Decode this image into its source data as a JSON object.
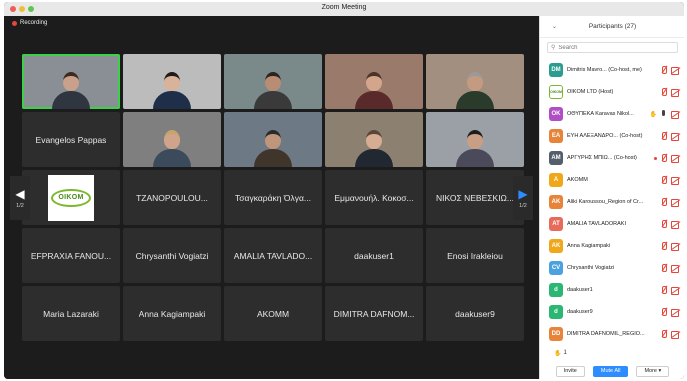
{
  "window": {
    "title": "Zoom Meeting"
  },
  "meeting": {
    "recording_label": "Recording",
    "page_left": "1/2",
    "page_right": "1/2",
    "logo_text": "OIKOM",
    "tiles": [
      {
        "kind": "video"
      },
      {
        "kind": "video"
      },
      {
        "kind": "video"
      },
      {
        "kind": "video"
      },
      {
        "kind": "video"
      },
      {
        "kind": "name",
        "name": "Evangelos Pappas"
      },
      {
        "kind": "video"
      },
      {
        "kind": "video"
      },
      {
        "kind": "video"
      },
      {
        "kind": "video"
      },
      {
        "kind": "logo"
      },
      {
        "kind": "name",
        "name": "TZANOPOULOU..."
      },
      {
        "kind": "name",
        "name": "Τσαγκαράκη Όλγα..."
      },
      {
        "kind": "name",
        "name": "Εμμανουήλ. Κοκοσ..."
      },
      {
        "kind": "name",
        "name": "ΝΙΚΟΣ ΝΕΒΕΣΚΙΩ..."
      },
      {
        "kind": "name",
        "name": "EFPRAXIA FANOU..."
      },
      {
        "kind": "name",
        "name": "Chrysanthi Vogiatzi"
      },
      {
        "kind": "name",
        "name": "AMALIA TAVLADO..."
      },
      {
        "kind": "name",
        "name": "daakuser1"
      },
      {
        "kind": "name",
        "name": "Enosi Irakleiou"
      },
      {
        "kind": "name",
        "name": "Maria Lazaraki"
      },
      {
        "kind": "name",
        "name": "Anna Kagiampaki"
      },
      {
        "kind": "name",
        "name": "AKOMM"
      },
      {
        "kind": "name",
        "name": "DIMITRA DAFNOM..."
      },
      {
        "kind": "name",
        "name": "daakuser9"
      }
    ]
  },
  "participants_panel": {
    "title": "Participants (27)",
    "search_placeholder": "Search",
    "rows": [
      {
        "initials": "DM",
        "color": "#2a9d8f",
        "name": "Dimitris Mavro... (Co-host, me)",
        "hand": false,
        "mic": "off",
        "cam": "off",
        "dot": false
      },
      {
        "initials": "OIKOM",
        "color": "#ffffff",
        "name": "OIKOM LTD (Host)",
        "hand": false,
        "mic": "off",
        "cam": "off",
        "dot": false,
        "logo": true
      },
      {
        "initials": "OK",
        "color": "#b04fc5",
        "name": "ΟΘΥΠΕΚΑ Karavas Nikol...",
        "hand": true,
        "mic": "on",
        "cam": "off",
        "dot": false
      },
      {
        "initials": "EA",
        "color": "#e8833a",
        "name": "ΕΥΗ ΑΛΕΞΑΝΔΡΟ... (Co-host)",
        "hand": false,
        "mic": "off",
        "cam": "off",
        "dot": false
      },
      {
        "initials": "AM",
        "color": "#555e6b",
        "name": "ΑΡΓΥΡΗΣ ΜΠΙΩ... (Co-host)",
        "hand": false,
        "mic": "off",
        "cam": "off",
        "dot": true
      },
      {
        "initials": "A",
        "color": "#f0a81a",
        "name": "AKOMM",
        "hand": false,
        "mic": "off",
        "cam": "off",
        "dot": false
      },
      {
        "initials": "AK",
        "color": "#e8833a",
        "name": "Aliki Karoussou_Region of Cr...",
        "hand": false,
        "mic": "off",
        "cam": "off",
        "dot": false
      },
      {
        "initials": "AT",
        "color": "#e86a5a",
        "name": "AMALIA TAVLADORAKI",
        "hand": false,
        "mic": "off",
        "cam": "off",
        "dot": false
      },
      {
        "initials": "AK",
        "color": "#f0a81a",
        "name": "Anna Kagiampaki",
        "hand": false,
        "mic": "off",
        "cam": "off",
        "dot": false
      },
      {
        "initials": "CV",
        "color": "#4aa3df",
        "name": "Chrysanthi Vogiatzi",
        "hand": false,
        "mic": "off",
        "cam": "off",
        "dot": false
      },
      {
        "initials": "d",
        "color": "#2bb673",
        "name": "daakuser1",
        "hand": false,
        "mic": "off",
        "cam": "off",
        "dot": false
      },
      {
        "initials": "d",
        "color": "#2bb673",
        "name": "daakuser9",
        "hand": false,
        "mic": "off",
        "cam": "off",
        "dot": false
      },
      {
        "initials": "DD",
        "color": "#e8833a",
        "name": "DIMITRA DAFNOMIL_REGIO...",
        "hand": false,
        "mic": "off",
        "cam": "off",
        "dot": false
      }
    ],
    "raised_hands_count": "1",
    "invite_label": "Invite",
    "mute_all_label": "Mute All",
    "more_label": "More ▾"
  }
}
